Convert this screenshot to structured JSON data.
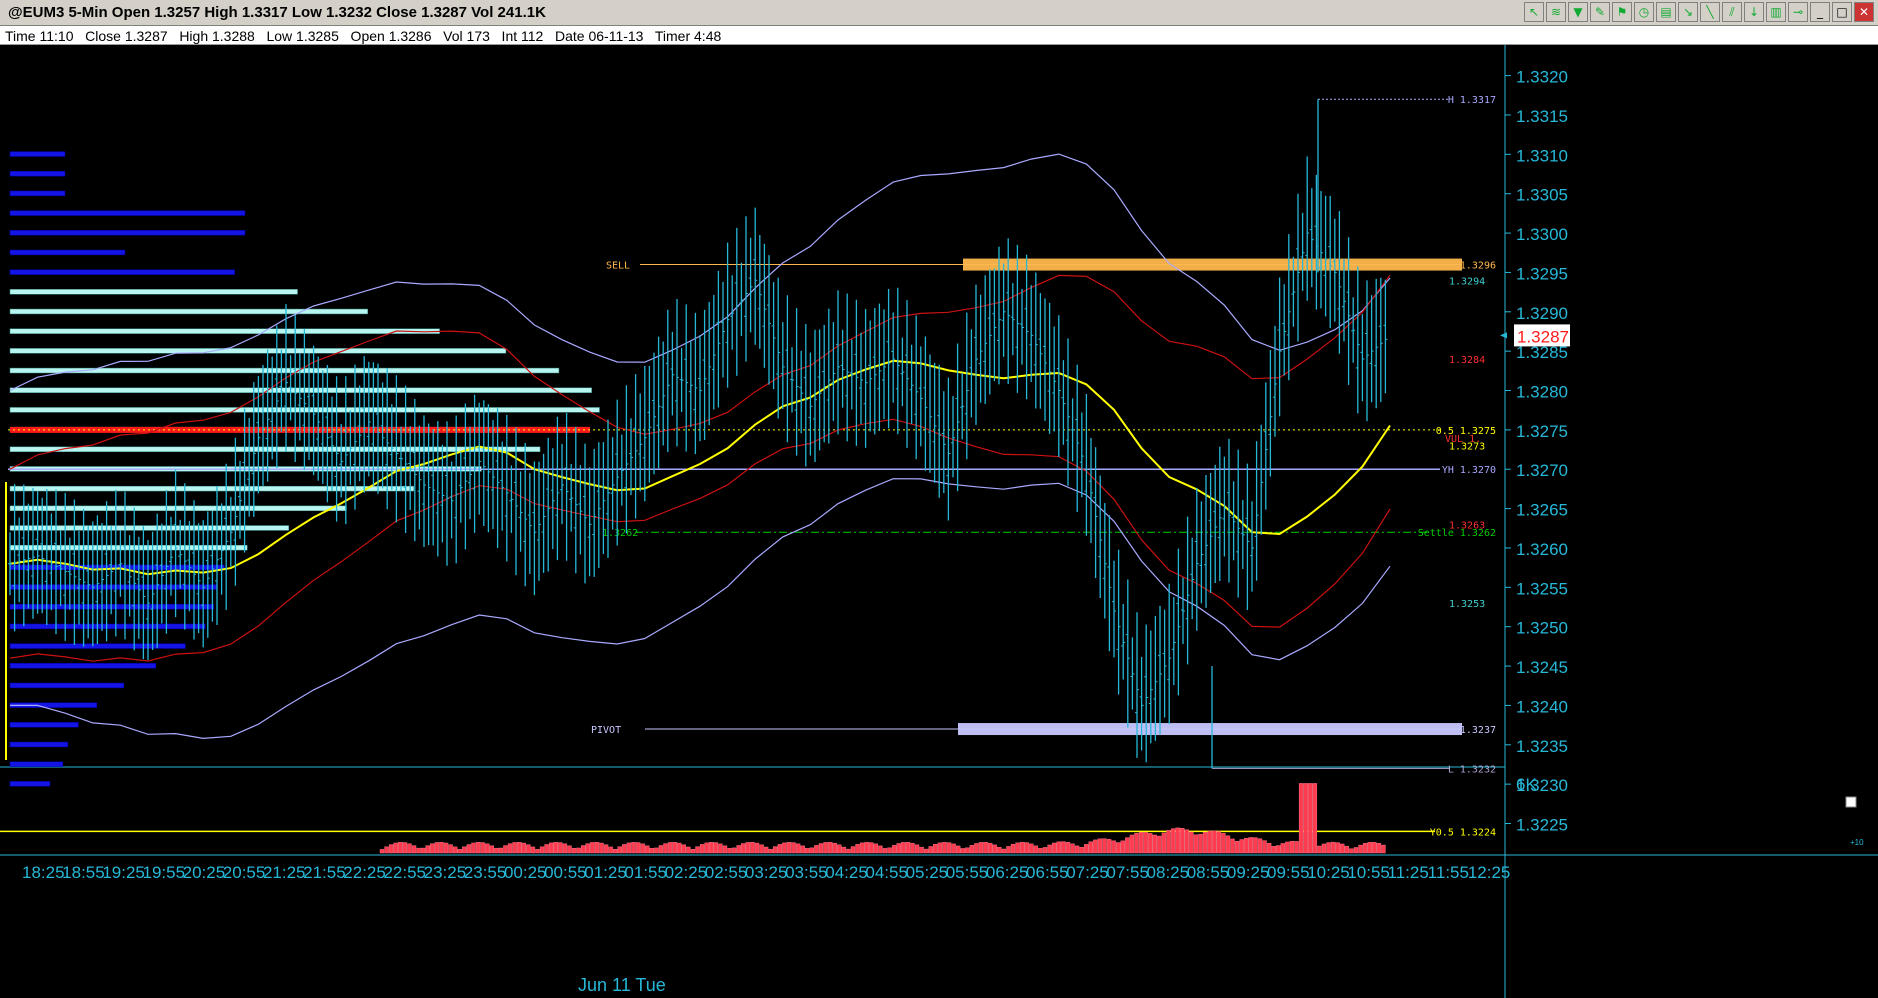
{
  "window": {
    "title": "@EUM3 5-Min Open 1.3257 High 1.3317 Low 1.3232 Close 1.3287 Vol 241.1K",
    "toolbar_icons": [
      "cursor-icon",
      "fibonacci-icon",
      "funnel-icon",
      "pencil-icon",
      "flag-icon",
      "stopwatch-icon",
      "calendar-icon",
      "arrow-icon",
      "drawing-line-icon",
      "channel-icon",
      "arrow-down-icon",
      "trash-icon",
      "pin-icon",
      "minimize-icon",
      "maximize-icon",
      "close-icon"
    ]
  },
  "infobar": {
    "text": "Time 11:10   Close 1.3287   High 1.3288   Low 1.3285   Open 1.3286   Vol 173   Int 112   Date 06-11-13   Timer 4:48"
  },
  "chart_data": {
    "type": "candlestick",
    "symbol": "@EUM3",
    "interval": "5-Min",
    "ylim": [
      1.3221,
      1.3323
    ],
    "y_ticks": [
      "1.3320",
      "1.3315",
      "1.3310",
      "1.3305",
      "1.3300",
      "1.3295",
      "1.3290",
      "1.3285",
      "1.3280",
      "1.3275",
      "1.3270",
      "1.3265",
      "1.3260",
      "1.3255",
      "1.3250",
      "1.3245",
      "1.3240",
      "1.3235",
      "1.3230",
      "1.3225"
    ],
    "current_price": "1.3287",
    "x_ticks": [
      "18:25",
      "18:55",
      "19:25",
      "19:55",
      "20:25",
      "20:55",
      "21:25",
      "21:55",
      "22:25",
      "22:55",
      "23:25",
      "23:55",
      "00:25",
      "00:55",
      "01:25",
      "01:55",
      "02:25",
      "02:55",
      "03:25",
      "03:55",
      "04:25",
      "04:55",
      "05:25",
      "05:55",
      "06:25",
      "06:55",
      "07:25",
      "07:55",
      "08:25",
      "08:55",
      "09:25",
      "09:55",
      "10:25",
      "10:55",
      "11:25",
      "11:55",
      "12:25"
    ],
    "date_label": "Jun 11 Tue",
    "volume_label": "6K",
    "volume_max": 6000,
    "price_lines": [
      {
        "name": "SELL",
        "value": 1.3296,
        "label": "1.3296",
        "color": "#ffb84d",
        "zone": true
      },
      {
        "name": "PIVOT",
        "value": 1.3237,
        "label": "1.3237",
        "color": "#c8c8ff",
        "zone": true
      },
      {
        "name": "H",
        "value": 1.3317,
        "label": "H 1.3317",
        "color": "#a9a9ff",
        "style": "dotted"
      },
      {
        "name": "L",
        "value": 1.3232,
        "label": "L 1.3232",
        "color": "#b0a0d0"
      },
      {
        "name": "YH",
        "value": 1.327,
        "label": "YH 1.3270",
        "color": "#a9a9ff"
      },
      {
        "name": "Settle",
        "value": 1.3262,
        "label": "Settle 1.3262",
        "left_label": "1.3262",
        "color": "#00cc00",
        "style": "dashdot"
      },
      {
        "name": "0.5",
        "value": 1.3275,
        "label": "0.5 1.3275",
        "color": "#ffff00",
        "style": "dotted"
      },
      {
        "name": "Y0.5",
        "value": 1.3224,
        "label": "Y0.5 1.3224",
        "color": "#ffff00"
      }
    ],
    "side_labels": [
      {
        "value": 1.3294,
        "text": "1.3294",
        "color": "#40d0d0"
      },
      {
        "value": 1.3284,
        "text": "1.3284",
        "color": "#ff3030"
      },
      {
        "value": 1.3273,
        "text": "1.3273",
        "color": "#ffff00"
      },
      {
        "value": 1.3274,
        "text": "VUL 1.",
        "color": "#ff3030"
      },
      {
        "value": 1.3263,
        "text": "1.3263",
        "color": "#ff3030"
      },
      {
        "value": 1.3253,
        "text": "1.3253",
        "color": "#40d0d0"
      }
    ],
    "series": [
      {
        "kind": "ohlc-bars",
        "color": "#27b8d8",
        "closes": [
          1.3258,
          1.3259,
          1.3257,
          1.3255,
          1.3258,
          1.3253,
          1.326,
          1.3255,
          1.3262,
          1.3274,
          1.3281,
          1.3277,
          1.3271,
          1.3276,
          1.3272,
          1.3268,
          1.3266,
          1.3271,
          1.3267,
          1.3262,
          1.3268,
          1.3263,
          1.3269,
          1.3274,
          1.3282,
          1.328,
          1.3289,
          1.3294,
          1.3283,
          1.3278,
          1.3283,
          1.3281,
          1.3284,
          1.3279,
          1.3272,
          1.3284,
          1.329,
          1.3287,
          1.328,
          1.327,
          1.3252,
          1.324,
          1.3246,
          1.3258,
          1.3265,
          1.326,
          1.3285,
          1.33,
          1.3295,
          1.3284,
          1.3287
        ]
      },
      {
        "kind": "vwap",
        "color": "#ffff00"
      },
      {
        "kind": "band",
        "color": "#a9a9ff"
      },
      {
        "kind": "band",
        "color": "#cc1111"
      },
      {
        "kind": "volume",
        "color": "#ff3b50"
      }
    ],
    "profile": {
      "poc": 1.3275,
      "value_area": [
        1.326,
        1.3294
      ]
    }
  }
}
